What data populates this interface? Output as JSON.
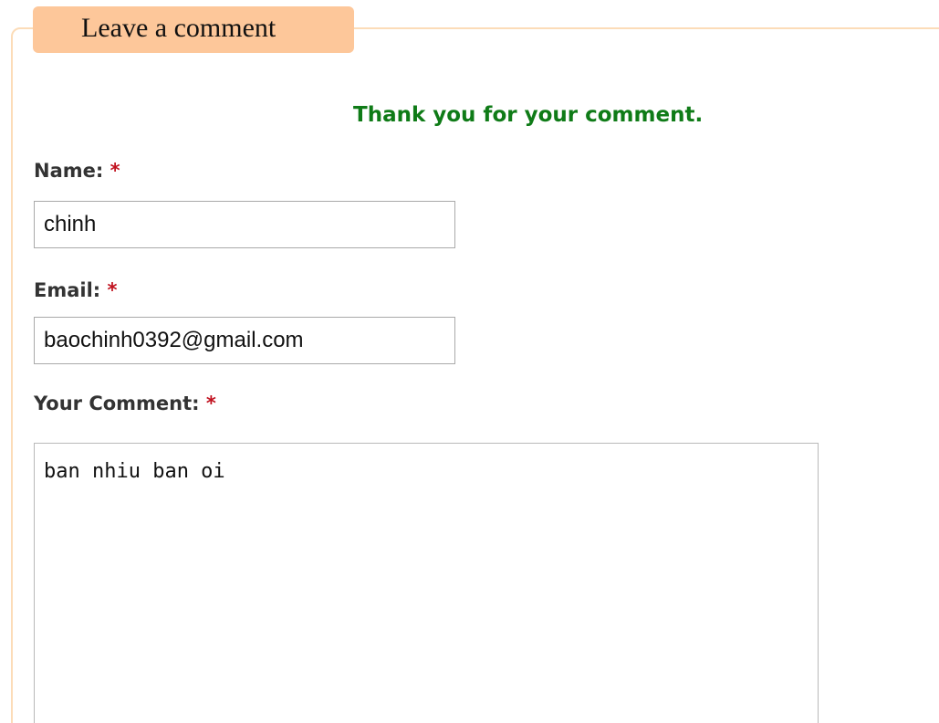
{
  "form": {
    "legend": "Leave a comment",
    "success_message": "Thank you for your comment.",
    "required_marker": "*",
    "name": {
      "label": "Name:",
      "value": "chinh"
    },
    "email": {
      "label": "Email:",
      "value": "baochinh0392@gmail.com"
    },
    "comment": {
      "label": "Your Comment:",
      "value": "ban nhiu ban oi"
    }
  },
  "colors": {
    "legend_background": "#fdc79a",
    "frame_border": "#fcdcb8",
    "success_text": "#0f7b17",
    "required_marker": "#c1121f",
    "label_text": "#333333"
  }
}
